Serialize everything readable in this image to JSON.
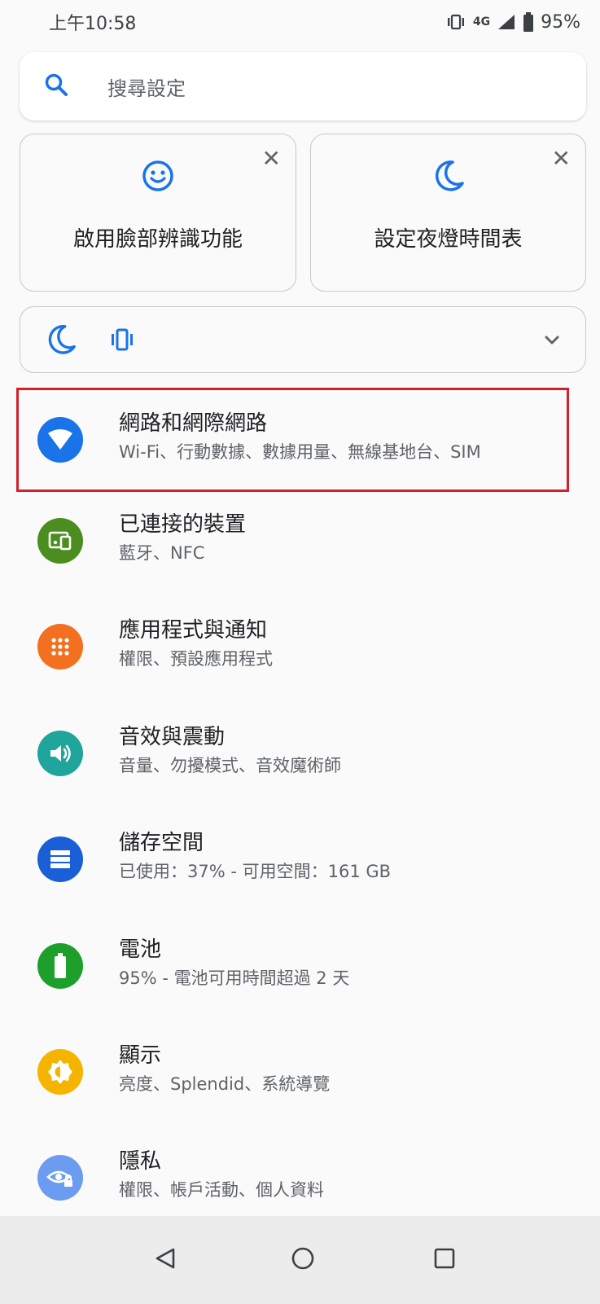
{
  "status_bar": {
    "time": "上午10:58",
    "network": "4G",
    "battery": "95%"
  },
  "search": {
    "placeholder": "搜尋設定"
  },
  "suggestions": [
    {
      "label": "啟用臉部辨識功能",
      "icon": "smiley-face-icon"
    },
    {
      "label": "設定夜燈時間表",
      "icon": "moon-icon"
    }
  ],
  "settings": [
    {
      "title": "網路和網際網路",
      "subtitle": "Wi-Fi、行動數據、數據用量、無線基地台、SIM",
      "icon": "wifi-icon",
      "color": "#1a73e8"
    },
    {
      "title": "已連接的裝置",
      "subtitle": "藍牙、NFC",
      "icon": "devices-icon",
      "color": "#4b8d1e"
    },
    {
      "title": "應用程式與通知",
      "subtitle": "權限、預設應用程式",
      "icon": "apps-grid-icon",
      "color": "#f2701f"
    },
    {
      "title": "音效與震動",
      "subtitle": "音量、勿擾模式、音效魔術師",
      "icon": "volume-icon",
      "color": "#1fa59b"
    },
    {
      "title": "儲存空間",
      "subtitle": "已使用：37% - 可用空間：161 GB",
      "icon": "storage-icon",
      "color": "#1a5fd6"
    },
    {
      "title": "電池",
      "subtitle": "95% - 電池可用時間超過 2 天",
      "icon": "battery-icon",
      "color": "#1e9f2c"
    },
    {
      "title": "顯示",
      "subtitle": "亮度、Splendid、系統導覽",
      "icon": "brightness-icon",
      "color": "#f5b400"
    },
    {
      "title": "隱私",
      "subtitle": "權限、帳戶活動、個人資料",
      "icon": "privacy-eye-icon",
      "color": "#6b9cf0"
    }
  ],
  "colors": {
    "accent": "#1a73e8",
    "highlight_border": "#d32029"
  }
}
